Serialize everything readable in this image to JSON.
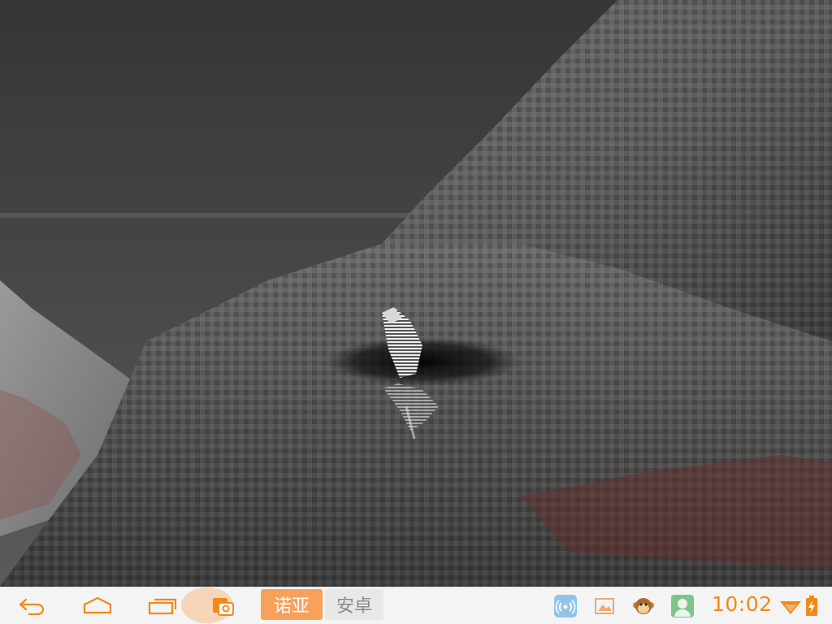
{
  "scene": {
    "description_icon": "3d-terrain-viewport",
    "character_icon": "striped-creature-model"
  },
  "navbar": {
    "back_icon": "back-arrow-icon",
    "home_icon": "home-icon",
    "recent_icon": "recent-apps-icon",
    "screenshot_icon": "screenshot-icon",
    "ime_tabs": [
      {
        "label": "诺亚",
        "active": true
      },
      {
        "label": "安卓",
        "active": false
      }
    ],
    "tray": [
      {
        "name": "wireless-debug-icon"
      },
      {
        "name": "gallery-icon"
      },
      {
        "name": "monkey-app-icon"
      },
      {
        "name": "avatar-app-icon"
      }
    ],
    "clock": "10:02",
    "accent_color": "#f0891a"
  }
}
